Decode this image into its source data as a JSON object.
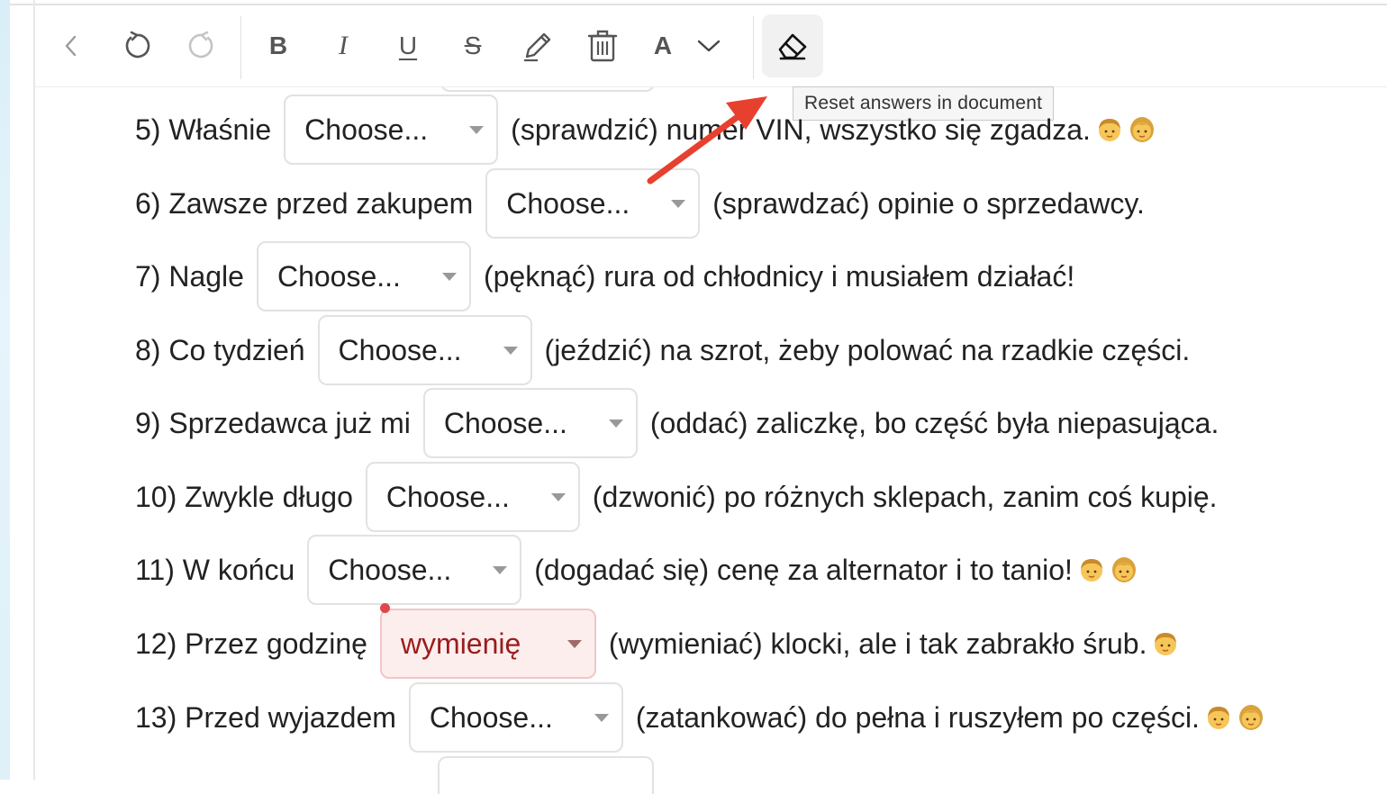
{
  "toolbar": {
    "tooltip": "Reset answers in document",
    "font_label": "A",
    "bold_label": "B",
    "italic_label": "I",
    "underline_label": "U",
    "strike_label": "S"
  },
  "exercise": {
    "rows": [
      {
        "prefix": "5) Właśnie",
        "select": "Choose...",
        "suffix": "(sprawdzić) numer VIN, wszystko się zgadza.",
        "emoji": [
          "man",
          "woman"
        ]
      },
      {
        "prefix": "6) Zawsze przed zakupem",
        "select": "Choose...",
        "suffix": "(sprawdzać) opinie o sprzedawcy.",
        "emoji": []
      },
      {
        "prefix": "7) Nagle",
        "select": "Choose...",
        "suffix": "(pęknąć) rura od chłodnicy i musiałem działać!",
        "emoji": []
      },
      {
        "prefix": "8) Co tydzień",
        "select": "Choose...",
        "suffix": "(jeździć) na szrot, żeby polować na rzadkie części.",
        "emoji": []
      },
      {
        "prefix": "9) Sprzedawca już mi",
        "select": "Choose...",
        "suffix": "(oddać) zaliczkę, bo część była niepasująca.",
        "emoji": []
      },
      {
        "prefix": "10) Zwykle długo",
        "select": "Choose...",
        "suffix": "(dzwonić) po różnych sklepach, zanim coś kupię.",
        "emoji": []
      },
      {
        "prefix": "11) W końcu",
        "select": "Choose...",
        "suffix": "(dogadać się) cenę za alternator i to tanio!",
        "emoji": [
          "man",
          "woman"
        ]
      },
      {
        "prefix": "12) Przez godzinę",
        "select": "wymienię",
        "suffix": "(wymieniać) klocki, ale i tak zabrakło śrub.",
        "emoji": [
          "man"
        ],
        "state": "wrong"
      },
      {
        "prefix": "13) Przed wyjazdem",
        "select": "Choose...",
        "suffix": "(zatankować) do pełna i ruszyłem po części.",
        "emoji": [
          "man",
          "woman"
        ]
      }
    ]
  },
  "colors": {
    "accent_arrow": "#e8402f",
    "wrong_bg": "#fdeeee",
    "wrong_text": "#9b1c1c"
  }
}
